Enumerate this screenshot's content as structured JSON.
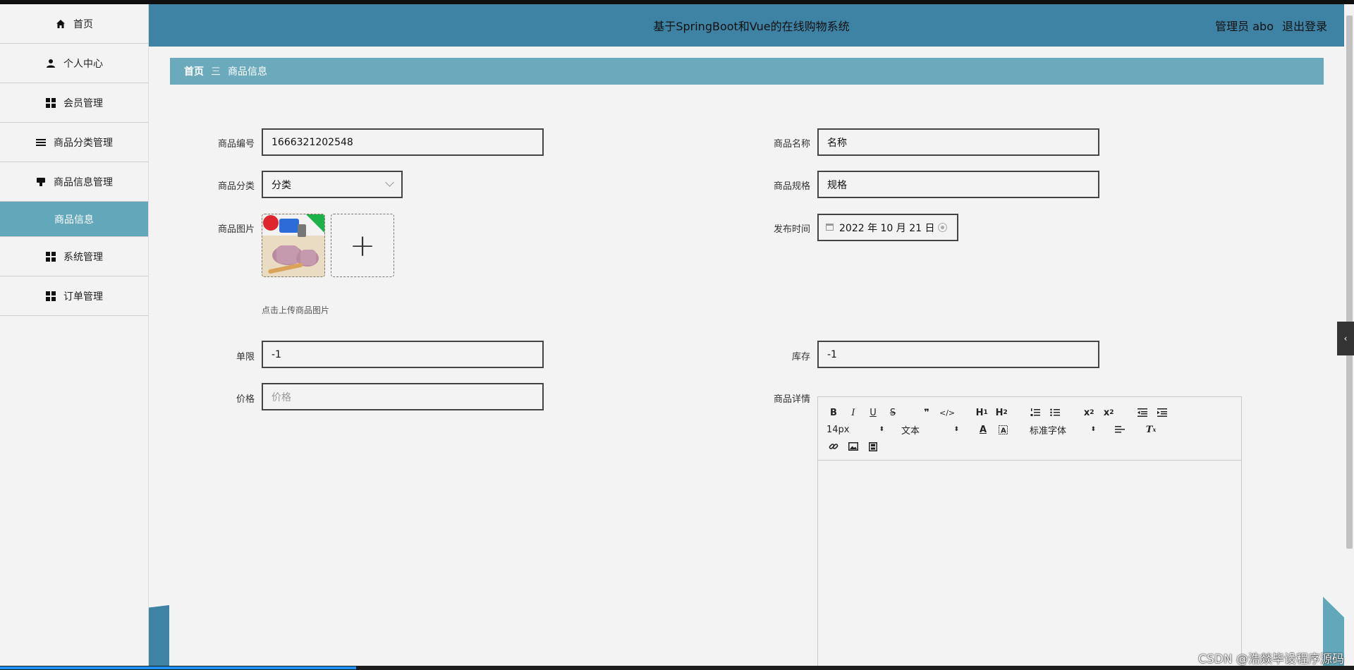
{
  "app": {
    "title": "基于SpringBoot和Vue的在线购物系统",
    "user_label": "管理员 abo",
    "logout_label": "退出登录"
  },
  "sidebar": {
    "items": [
      {
        "label": "首页",
        "icon": "home-icon"
      },
      {
        "label": "个人中心",
        "icon": "user-icon"
      },
      {
        "label": "会员管理",
        "icon": "grid-icon"
      },
      {
        "label": "商品分类管理",
        "icon": "list-icon"
      },
      {
        "label": "商品信息管理",
        "icon": "product-icon"
      }
    ],
    "active_sub": "商品信息",
    "more_items": [
      {
        "label": "系统管理",
        "icon": "grid-icon"
      },
      {
        "label": "订单管理",
        "icon": "grid-icon"
      }
    ]
  },
  "breadcrumb": {
    "home": "首页",
    "separator": "三",
    "current": "商品信息"
  },
  "form": {
    "product_code": {
      "label": "商品编号",
      "value": "1666321202548"
    },
    "product_name": {
      "label": "商品名称",
      "value": "名称"
    },
    "category": {
      "label": "商品分类",
      "value": "分类"
    },
    "spec": {
      "label": "商品规格",
      "value": "规格"
    },
    "image": {
      "label": "商品图片",
      "hint": "点击上传商品图片"
    },
    "publish_time": {
      "label": "发布时间",
      "value": "2022 年 10 月 21 日"
    },
    "limit": {
      "label": "单限",
      "value": "-1"
    },
    "stock": {
      "label": "库存",
      "value": "-1"
    },
    "price": {
      "label": "价格",
      "placeholder": "价格"
    },
    "details": {
      "label": "商品详情"
    }
  },
  "editor": {
    "font_size": "14px",
    "block_type": "文本",
    "font_family": "标准字体"
  },
  "watermark": "CSDN @浩燚毕设程序源码",
  "colors": {
    "header": "#3e82a4",
    "breadcrumb": "#6aaabc",
    "active_sub": "#62a8ba"
  }
}
